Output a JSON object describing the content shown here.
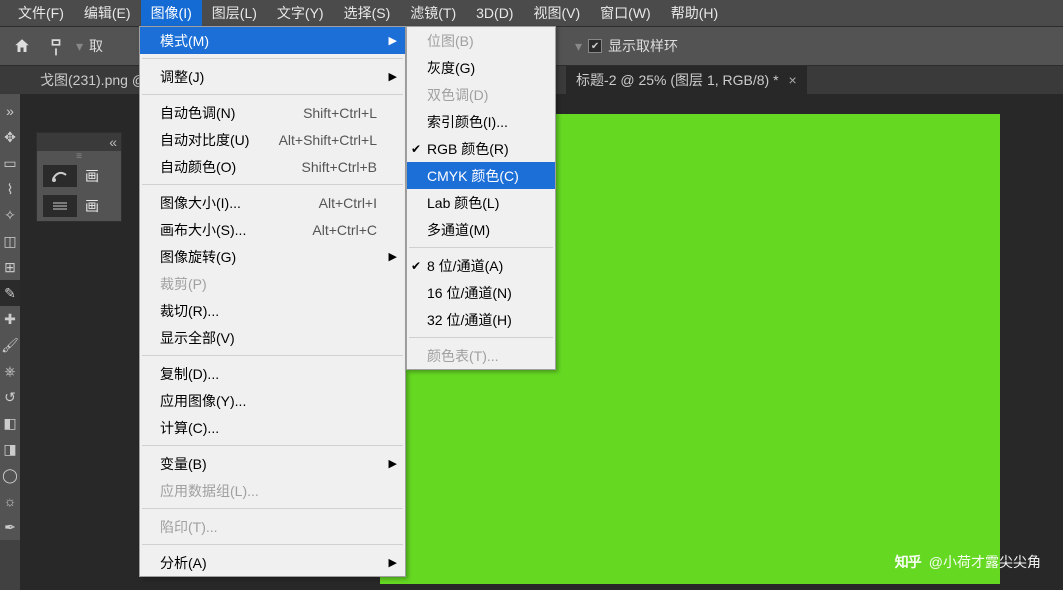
{
  "menubar": {
    "items": [
      "文件(F)",
      "编辑(E)",
      "图像(I)",
      "图层(L)",
      "文字(Y)",
      "选择(S)",
      "滤镜(T)",
      "3D(D)",
      "视图(V)",
      "窗口(W)",
      "帮助(H)"
    ],
    "active_index": 2
  },
  "optbar": {
    "sample_prefix": "取",
    "show_ring": "显示取样环"
  },
  "tabs": {
    "left": "戈图(231).png @",
    "right_prefix": "标题-2 @ 25% (图层 1, RGB/8) *"
  },
  "brushpanel": {
    "row1": "画",
    "row2": "画"
  },
  "image_menu": {
    "items": [
      {
        "label": "模式(M)",
        "arrow": true,
        "hl": true
      },
      {
        "sep": true
      },
      {
        "label": "调整(J)",
        "arrow": true
      },
      {
        "sep": true
      },
      {
        "label": "自动色调(N)",
        "sc": "Shift+Ctrl+L"
      },
      {
        "label": "自动对比度(U)",
        "sc": "Alt+Shift+Ctrl+L"
      },
      {
        "label": "自动颜色(O)",
        "sc": "Shift+Ctrl+B"
      },
      {
        "sep": true
      },
      {
        "label": "图像大小(I)...",
        "sc": "Alt+Ctrl+I"
      },
      {
        "label": "画布大小(S)...",
        "sc": "Alt+Ctrl+C"
      },
      {
        "label": "图像旋转(G)",
        "arrow": true
      },
      {
        "label": "裁剪(P)",
        "disabled": true
      },
      {
        "label": "裁切(R)..."
      },
      {
        "label": "显示全部(V)"
      },
      {
        "sep": true
      },
      {
        "label": "复制(D)..."
      },
      {
        "label": "应用图像(Y)..."
      },
      {
        "label": "计算(C)..."
      },
      {
        "sep": true
      },
      {
        "label": "变量(B)",
        "arrow": true
      },
      {
        "label": "应用数据组(L)...",
        "disabled": true
      },
      {
        "sep": true
      },
      {
        "label": "陷印(T)...",
        "disabled": true
      },
      {
        "sep": true
      },
      {
        "label": "分析(A)",
        "arrow": true
      }
    ]
  },
  "mode_menu": {
    "items": [
      {
        "label": "位图(B)",
        "disabled": true
      },
      {
        "label": "灰度(G)"
      },
      {
        "label": "双色调(D)",
        "disabled": true
      },
      {
        "label": "索引颜色(I)..."
      },
      {
        "label": "RGB 颜色(R)",
        "check": true
      },
      {
        "label": "CMYK 颜色(C)",
        "hl": true
      },
      {
        "label": "Lab 颜色(L)"
      },
      {
        "label": "多通道(M)"
      },
      {
        "sep": true
      },
      {
        "label": "8 位/通道(A)",
        "check": true
      },
      {
        "label": "16 位/通道(N)"
      },
      {
        "label": "32 位/通道(H)"
      },
      {
        "sep": true
      },
      {
        "label": "颜色表(T)...",
        "disabled": true
      }
    ]
  },
  "watermark": {
    "logo": "知乎",
    "text": "@小荷才露尖尖角"
  }
}
